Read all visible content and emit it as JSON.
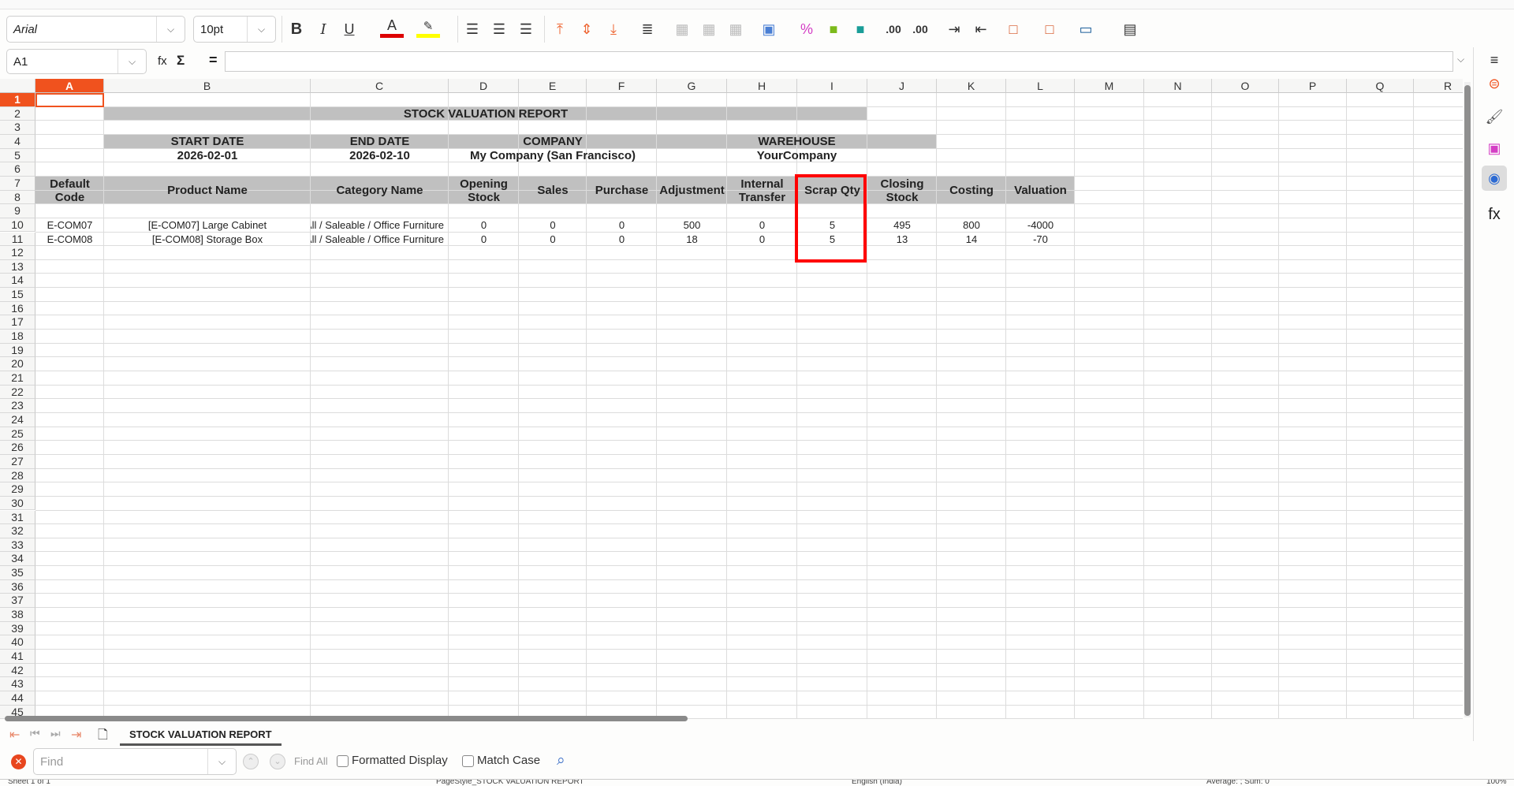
{
  "toolbar": {
    "font_name": "Arial",
    "font_size": "10pt"
  },
  "formula_bar": {
    "name_box": "A1",
    "fx": "fx",
    "sum": "Σ",
    "equals": "=",
    "content": ""
  },
  "sheet": {
    "columns": [
      "A",
      "B",
      "C",
      "D",
      "E",
      "F",
      "G",
      "H",
      "I",
      "J",
      "K",
      "L",
      "M",
      "N",
      "O",
      "P",
      "Q",
      "R"
    ],
    "row_count": 45,
    "active_cell": "A1",
    "header_fill": "#c0c0c0",
    "highlight_color": "#ff0000",
    "cells": [
      {
        "range": "B2:I2",
        "text": "STOCK VALUATION REPORT",
        "bold": true,
        "fill": true
      },
      {
        "range": "B4:B4",
        "text": "START DATE",
        "bold": true,
        "fill": true
      },
      {
        "range": "C4:C4",
        "text": "END DATE",
        "bold": true,
        "fill": true
      },
      {
        "range": "D4:F4",
        "text": "COMPANY",
        "bold": true,
        "fill": true
      },
      {
        "range": "G4:J4",
        "text": "WAREHOUSE",
        "bold": true,
        "fill": true
      },
      {
        "range": "B5:B5",
        "text": "2026-02-01",
        "bold": true
      },
      {
        "range": "C5:C5",
        "text": "2026-02-10",
        "bold": true
      },
      {
        "range": "D5:F5",
        "text": "My Company (San Francisco)",
        "bold": true
      },
      {
        "range": "G5:J5",
        "text": "YourCompany",
        "bold": true
      },
      {
        "range": "A7:A8",
        "text": "Default\nCode",
        "bold": true,
        "fill": true
      },
      {
        "range": "B7:B8",
        "text": "Product Name",
        "bold": true,
        "fill": true
      },
      {
        "range": "C7:C8",
        "text": "Category Name",
        "bold": true,
        "fill": true
      },
      {
        "range": "D7:D8",
        "text": "Opening\nStock",
        "bold": true,
        "fill": true
      },
      {
        "range": "E7:E8",
        "text": "Sales",
        "bold": true,
        "fill": true
      },
      {
        "range": "F7:F8",
        "text": "Purchase",
        "bold": true,
        "fill": true
      },
      {
        "range": "G7:G8",
        "text": "Adjustment",
        "bold": true,
        "fill": true
      },
      {
        "range": "H7:H8",
        "text": "Internal\nTransfer",
        "bold": true,
        "fill": true
      },
      {
        "range": "I7:I8",
        "text": "Scrap Qty",
        "bold": true,
        "fill": true
      },
      {
        "range": "J7:J8",
        "text": "Closing\nStock",
        "bold": true,
        "fill": true
      },
      {
        "range": "K7:K8",
        "text": "Costing",
        "bold": true,
        "fill": true
      },
      {
        "range": "L7:L8",
        "text": "Valuation",
        "bold": true,
        "fill": true
      },
      {
        "range": "A10:A10",
        "text": "E-COM07"
      },
      {
        "range": "B10:B10",
        "text": "[E-COM07] Large Cabinet"
      },
      {
        "range": "C10:C10",
        "text": "All / Saleable / Office Furniture"
      },
      {
        "range": "D10:D10",
        "text": "0"
      },
      {
        "range": "E10:E10",
        "text": "0"
      },
      {
        "range": "F10:F10",
        "text": "0"
      },
      {
        "range": "G10:G10",
        "text": "500"
      },
      {
        "range": "H10:H10",
        "text": "0"
      },
      {
        "range": "I10:I10",
        "text": "5"
      },
      {
        "range": "J10:J10",
        "text": "495"
      },
      {
        "range": "K10:K10",
        "text": "800"
      },
      {
        "range": "L10:L10",
        "text": "-4000"
      },
      {
        "range": "A11:A11",
        "text": "E-COM08"
      },
      {
        "range": "B11:B11",
        "text": "[E-COM08] Storage Box"
      },
      {
        "range": "C11:C11",
        "text": "All / Saleable / Office Furniture"
      },
      {
        "range": "D11:D11",
        "text": "0"
      },
      {
        "range": "E11:E11",
        "text": "0"
      },
      {
        "range": "F11:F11",
        "text": "0"
      },
      {
        "range": "G11:G11",
        "text": "18"
      },
      {
        "range": "H11:H11",
        "text": "0"
      },
      {
        "range": "I11:I11",
        "text": "5"
      },
      {
        "range": "J11:J11",
        "text": "13"
      },
      {
        "range": "K11:K11",
        "text": "14"
      },
      {
        "range": "L11:L11",
        "text": "-70"
      }
    ],
    "highlight_range": "I7:I12"
  },
  "tabs": {
    "active": "STOCK VALUATION REPORT"
  },
  "find": {
    "placeholder": "Find",
    "find_all": "Find All",
    "formatted_display": "Formatted Display",
    "match_case": "Match Case"
  },
  "status": {
    "sheet": "Sheet 1 of 1",
    "page_style": "PageStyle_STOCK VALUATION REPORT",
    "language": "English (India)",
    "summary": "Average: ; Sum: 0",
    "zoom": "100%"
  }
}
